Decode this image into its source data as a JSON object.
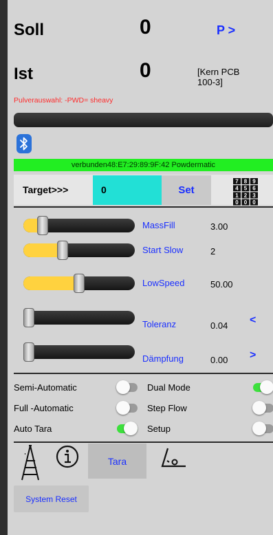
{
  "header": {
    "soll_label": "Soll",
    "soll_value": "0",
    "p_button": "P >",
    "ist_label": "Ist",
    "ist_value": "0",
    "scale_name": "[Kern PCB 100-3]",
    "pulver_info": "Pulverauswahl: -PWD= sheavy"
  },
  "connection": {
    "status_text": "verbunden48:E7:29:89:9F:42 Powdermatic",
    "bluetooth_icon": "bluetooth-icon"
  },
  "target": {
    "label": "Target>>>",
    "value": "0",
    "set_label": "Set",
    "keypad_digits": [
      "7",
      "8",
      "9",
      "4",
      "5",
      "6",
      "1",
      "2",
      "3",
      "0",
      "0",
      "0"
    ]
  },
  "sliders": [
    {
      "name": "MassFill",
      "value": "3.00",
      "fill": 0.17
    },
    {
      "name": "Start Slow",
      "value": "2",
      "fill": 0.35
    },
    {
      "name": "LowSpeed",
      "value": "50.00",
      "fill": 0.5
    },
    {
      "name": "Toleranz",
      "value": "0.04",
      "fill": 0.05
    },
    {
      "name": "Dämpfung",
      "value": "0.00",
      "fill": 0.0
    }
  ],
  "nav": {
    "prev": "<",
    "next": ">"
  },
  "switches": [
    {
      "label": "Semi-Automatic",
      "on": false
    },
    {
      "label": "Dual Mode",
      "on": true
    },
    {
      "label": "Full  -Automatic",
      "on": false
    },
    {
      "label": "Step Flow",
      "on": false
    },
    {
      "label": "Auto Tara",
      "on": true
    },
    {
      "label": "Setup",
      "on": false
    }
  ],
  "toolbar": {
    "info_icon": "info-icon",
    "ladder_icon": "ladder-icon",
    "tara_label": "Tara",
    "angle_icon": "angle-icon"
  },
  "system_reset_label": "System Reset",
  "colors": {
    "accent_blue": "#1a2fff",
    "status_green": "#22ee22",
    "target_cyan": "#22e0d6",
    "slider_yellow": "#ffd23f",
    "warning_red": "#ff2a2a"
  }
}
